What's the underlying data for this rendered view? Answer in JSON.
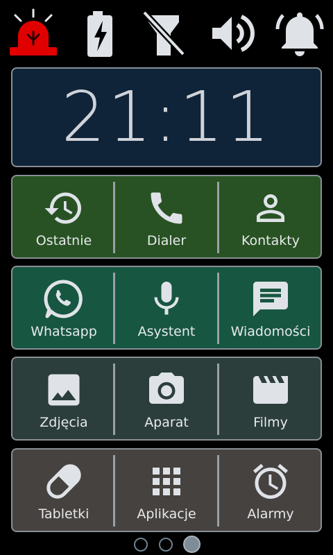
{
  "status_bar": {
    "icons": [
      "alarm-siren-icon",
      "battery-charging-icon",
      "flashlight-off-icon",
      "volume-icon",
      "notification-bell-icon"
    ]
  },
  "clock": {
    "time": "21:11"
  },
  "rows": [
    {
      "color": "#285223",
      "tiles": [
        {
          "label": "Ostatnie",
          "icon": "history-icon"
        },
        {
          "label": "Dialer",
          "icon": "phone-icon"
        },
        {
          "label": "Kontakty",
          "icon": "contact-person-icon"
        }
      ]
    },
    {
      "color": "#175641",
      "tiles": [
        {
          "label": "Whatsapp",
          "icon": "whatsapp-icon"
        },
        {
          "label": "Asystent",
          "icon": "microphone-icon"
        },
        {
          "label": "Wiadomości",
          "icon": "message-icon"
        }
      ]
    },
    {
      "color": "#2b3e3b",
      "tiles": [
        {
          "label": "Zdjęcia",
          "icon": "photo-icon"
        },
        {
          "label": "Aparat",
          "icon": "camera-icon"
        },
        {
          "label": "Filmy",
          "icon": "movie-clapper-icon"
        }
      ]
    },
    {
      "color": "#46423f",
      "tiles": [
        {
          "label": "Tabletki",
          "icon": "pill-icon"
        },
        {
          "label": "Aplikacje",
          "icon": "apps-grid-icon"
        },
        {
          "label": "Alarmy",
          "icon": "alarm-clock-icon"
        }
      ]
    }
  ],
  "pager": {
    "page_count": 3,
    "current_page": 3
  },
  "colors": {
    "icon": "#dfe3e8",
    "siren": "#e10000",
    "border": "#8a8f96",
    "clock_bg": "#0f2438"
  }
}
